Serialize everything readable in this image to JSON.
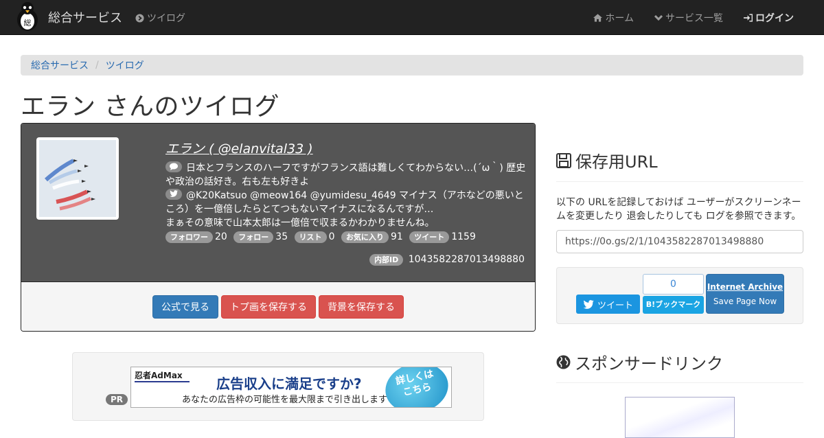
{
  "nav": {
    "brand": "総合サービス",
    "left_item": "ツイログ",
    "right_items": [
      "ホーム",
      "サービス一覧",
      "ログイン"
    ]
  },
  "breadcrumb": [
    "総合サービス",
    "ツイログ"
  ],
  "page_title": "エラン さんのツイログ",
  "profile": {
    "name": "エラン ( @elanvital33 )",
    "bio": "日本とフランスのハーフですがフランス語は難しくてわからない…(´ω｀) 歴史や政治の話好き。右も左も好きよ",
    "tweet": "@K20Katsuo @meow164 @yumidesu_4649 マイナス（アホなどの悪いところ）を一億倍したらとてつもないマイナスになるんですが…",
    "tweet2": "まぁその意味で山本太郎は一億倍で収まるかわかりませんね。",
    "stats": [
      {
        "label": "フォロワー",
        "value": "20"
      },
      {
        "label": "フォロー",
        "value": "35"
      },
      {
        "label": "リスト",
        "value": "0"
      },
      {
        "label": "お気に入り",
        "value": "91"
      },
      {
        "label": "ツイート",
        "value": "1159"
      }
    ],
    "internal_id_label": "内部ID",
    "internal_id": "1043582287013498880",
    "buttons": {
      "official": "公式で見る",
      "save_icon": "トプ画を保存する",
      "save_bg": "背景を保存する"
    }
  },
  "ad": {
    "pr": "PR",
    "logo": "忍者AdMax",
    "headline": "広告収入に満足ですか?",
    "sub": "あなたの広告枠の可能性を最大限まで引き出します",
    "cta_line1": "詳しくは",
    "cta_line2": "こちら"
  },
  "side": {
    "save_title": "保存用URL",
    "save_desc": "以下の URLを記録しておけば ユーザーがスクリーンネームを変更したり 退会したりしても ログを参照できます。",
    "url": "https://0o.gs/2/1/1043582287013498880",
    "tweet_btn": "ツイート",
    "hatena_count": "0",
    "hatena_btn": "B!ブックマーク",
    "archive_title": "Internet Archive",
    "archive_sub": "Save Page Now",
    "sponsor_title": "スポンサードリンク"
  },
  "colors": {
    "navbar": "#222222",
    "card_top": "#555555",
    "primary": "#337ab7",
    "danger": "#d9534f",
    "twitter": "#1b95e0"
  }
}
